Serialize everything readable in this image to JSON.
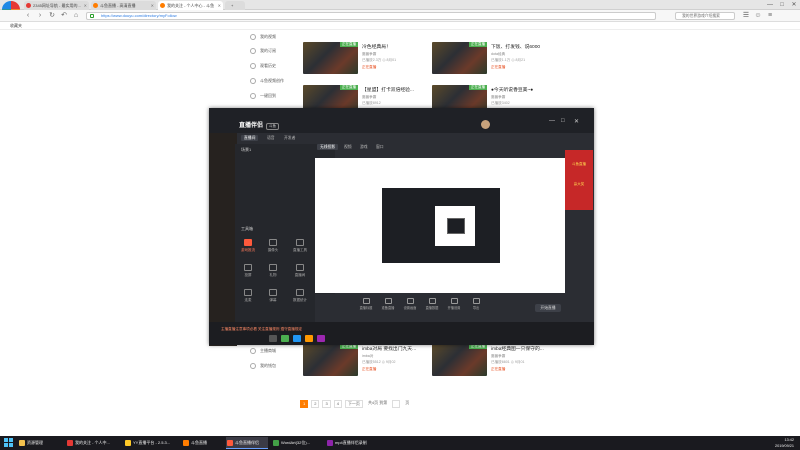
{
  "browser": {
    "logo_label": "2345浏览器",
    "tabs": [
      {
        "label": "2345网址导航 - 最实用的...",
        "color": "#e53935"
      },
      {
        "label": "斗鱼直播 - 高清直播",
        "color": "#ff7d00"
      },
      {
        "label": "我的关注 - 个人中心 - 斗鱼",
        "color": "#ff7d00",
        "active": true
      },
      {
        "label": "新标签页",
        "color": "#4caf50"
      }
    ],
    "window_controls": [
      "—",
      "□",
      "✕"
    ],
    "address": "https://www.douyu.com/directory/myFollow",
    "search_placeholder": "我的世界游戏介绍搜索",
    "bookmark_label": "收藏夹"
  },
  "sidebar": {
    "items": [
      {
        "label": "我的视频",
        "icon": "video-icon"
      },
      {
        "label": "我的订阅",
        "icon": "subscribe-icon"
      },
      {
        "label": "观看历史",
        "icon": "history-icon"
      },
      {
        "label": "斗鱼视频创作",
        "icon": "create-icon"
      },
      {
        "label": "一键回到",
        "icon": "arrow-icon"
      },
      {
        "label": "主播商城",
        "icon": "shop-icon"
      },
      {
        "label": "我的钱包",
        "icon": "wallet-icon"
      }
    ]
  },
  "cards": [
    {
      "title": "冷色经典局！",
      "sub": "魔兽争霸",
      "meta": "已播放2.3万  ◎ 8月01",
      "status": "正在直播",
      "tag": "正在直播"
    },
    {
      "title": "下饭、打发钱、说6000",
      "sub": "dota经典",
      "meta": "已播放1.1万  ◎ 8月21",
      "status": "正在直播",
      "tag": "正在直播"
    },
    {
      "title": "【星盟】打卡双倍经验...",
      "sub": "魔兽争霸",
      "meta": "已播放8912",
      "status": "正在直播",
      "tag": "正在直播"
    },
    {
      "title": "●今天听说香豆美~●",
      "sub": "魔兽争霸",
      "meta": "已播放3402",
      "status": "正在直播",
      "tag": "正在直播"
    },
    {
      "title": "imba对局 要找出门九天...",
      "sub": "imba对",
      "meta": "已播放5512  ◎ 9月02",
      "status": "正在直播",
      "tag": "正在直播"
    },
    {
      "title": "imba经典图一只保守的...",
      "sub": "魔兽争霸",
      "meta": "已播放6601  ◎ 9月01",
      "status": "正在直播",
      "tag": "正在直播"
    }
  ],
  "pager": {
    "pages": [
      "1",
      "2",
      "3",
      "4",
      "下一页",
      "共4页 到第",
      "页"
    ]
  },
  "app": {
    "title": "直播伴侣",
    "title_badge": "斗鱼",
    "tabs": [
      "直播间",
      "语音",
      "开发者"
    ],
    "toolbar_label": "工具箱",
    "scene_label": "场景1",
    "scene_tabs": [
      "无线投影",
      "视频",
      "游戏",
      "窗口"
    ],
    "tools": [
      {
        "label": "游戏推流",
        "icon": "gamepad-icon",
        "active": true
      },
      {
        "label": "摄像头",
        "icon": "camera-icon"
      },
      {
        "label": "直播工具",
        "icon": "tools-icon"
      },
      {
        "label": "投屏",
        "icon": "cast-icon"
      },
      {
        "label": "礼物",
        "icon": "gift-icon"
      },
      {
        "label": "直播间",
        "icon": "room-icon"
      },
      {
        "label": "连麦",
        "icon": "mic-icon"
      },
      {
        "label": "弹幕",
        "icon": "chat-icon"
      },
      {
        "label": "数据统计",
        "icon": "chart-icon"
      }
    ],
    "bottom_tools": [
      {
        "label": "直播标题",
        "icon": "title-icon"
      },
      {
        "label": "准备直播",
        "icon": "ready-icon"
      },
      {
        "label": "设置画面",
        "icon": "screen-icon"
      },
      {
        "label": "直播数据",
        "icon": "data-icon"
      },
      {
        "label": "开播设置",
        "icon": "settings-icon"
      },
      {
        "label": "导出",
        "icon": "export-icon"
      }
    ],
    "start_button": "开始直播",
    "status_text": "主播直播注意事项必看 关注直播规则 遵守直播规定",
    "ad_text": [
      "斗鱼直播",
      "赢大奖"
    ]
  },
  "taskbar": {
    "items": [
      {
        "label": "资源管理",
        "color": "#f2c14e"
      },
      {
        "label": "我的关注 - 个人中...",
        "color": "#e53935"
      },
      {
        "label": "YY直播平台 - 2.5.3...",
        "color": "#ffca28"
      },
      {
        "label": "斗鱼直播",
        "color": "#ff7d00"
      },
      {
        "label": "斗鱼直播伴侣",
        "color": "#ff5a3c",
        "active": true
      },
      {
        "label": "WordArt(32位)...",
        "color": "#43a047"
      },
      {
        "label": "mp4直播伴侣录制",
        "color": "#8e24aa"
      }
    ],
    "time": "13:42",
    "date": "2019/09/21"
  }
}
